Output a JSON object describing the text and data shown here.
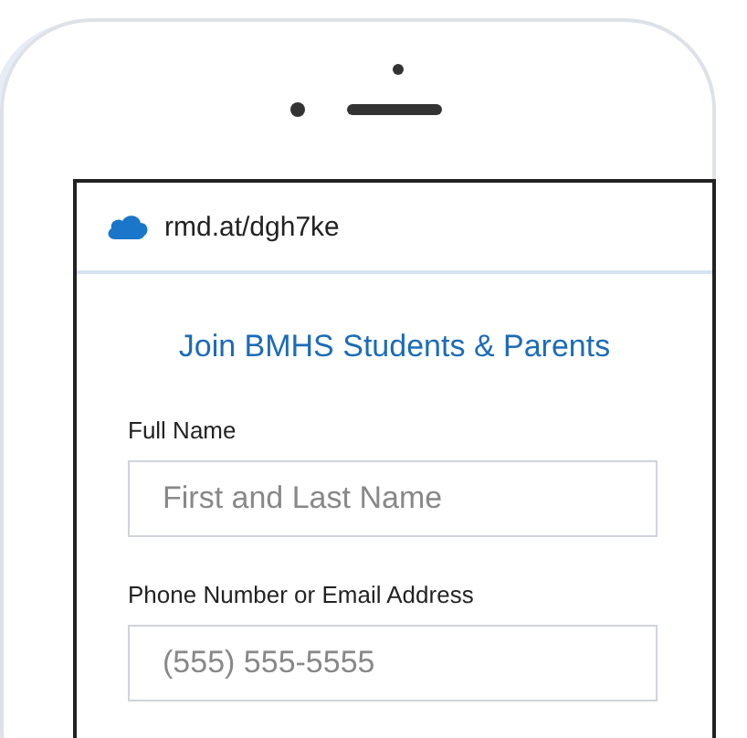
{
  "address_bar": {
    "url": "rmd.at/dgh7ke"
  },
  "form": {
    "title": "Join BMHS Students & Parents",
    "fields": [
      {
        "label": "Full Name",
        "placeholder": "First and Last Name"
      },
      {
        "label": "Phone Number or Email Address",
        "placeholder": "(555) 555-5555"
      }
    ]
  }
}
